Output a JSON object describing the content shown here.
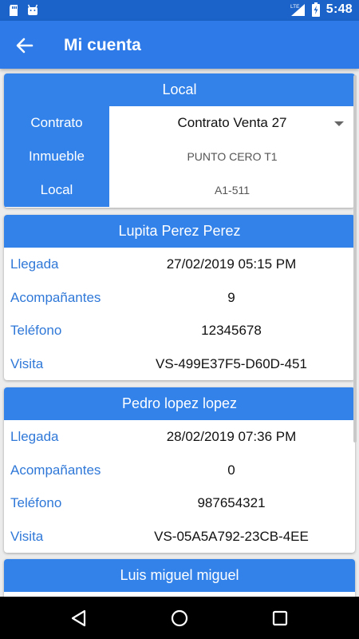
{
  "status_bar": {
    "time": "5:48",
    "network": "LTE",
    "icons": [
      "sd-card-icon",
      "android-icon",
      "lte-signal-icon",
      "battery-charging-icon"
    ]
  },
  "app_bar": {
    "title": "Mi cuenta",
    "back_icon": "arrow-back-icon"
  },
  "local_card": {
    "header": "Local",
    "rows": [
      {
        "label": "Contrato",
        "value": "Contrato Venta 27"
      },
      {
        "label": "Inmueble",
        "value": "PUNTO CERO T1"
      },
      {
        "label": "Local",
        "value": "A1-511"
      }
    ]
  },
  "visitors": [
    {
      "name": "Lupita Perez Perez",
      "rows": [
        {
          "label": "Llegada",
          "value": "27/02/2019 05:15 PM"
        },
        {
          "label": "Acompañantes",
          "value": "9"
        },
        {
          "label": "Teléfono",
          "value": "12345678"
        },
        {
          "label": "Visita",
          "value": "VS-499E37F5-D60D-451"
        }
      ]
    },
    {
      "name": "Pedro lopez lopez",
      "rows": [
        {
          "label": "Llegada",
          "value": "28/02/2019 07:36 PM"
        },
        {
          "label": "Acompañantes",
          "value": "0"
        },
        {
          "label": "Teléfono",
          "value": "987654321"
        },
        {
          "label": "Visita",
          "value": "VS-05A5A792-23CB-4EE"
        }
      ]
    },
    {
      "name": "Luis miguel miguel",
      "rows": []
    }
  ],
  "colors": {
    "status_bar": "#1b63c9",
    "app_bar": "#2d7ae8",
    "card_header": "#3282ea",
    "label_text": "#2f78d8"
  },
  "nav_bar": {
    "icons": [
      "back-triangle-icon",
      "home-circle-icon",
      "recents-square-icon"
    ]
  }
}
